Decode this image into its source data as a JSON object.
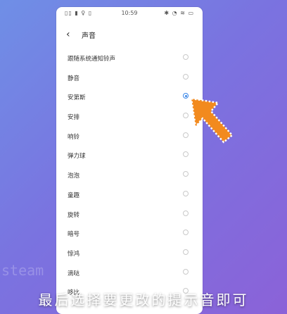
{
  "statusbar": {
    "left": "▯▯ ▮ ♀ ▯",
    "time": "10:59",
    "right": "✱ ◔ ≋ ▭"
  },
  "header": {
    "back_icon": "‹",
    "title": "声音"
  },
  "sounds": [
    {
      "label": "跟随系统通知铃声",
      "selected": false
    },
    {
      "label": "静音",
      "selected": false
    },
    {
      "label": "安第斯",
      "selected": true
    },
    {
      "label": "安排",
      "selected": false
    },
    {
      "label": "响铃",
      "selected": false
    },
    {
      "label": "弹力球",
      "selected": false
    },
    {
      "label": "泡泡",
      "selected": false
    },
    {
      "label": "童趣",
      "selected": false
    },
    {
      "label": "旋转",
      "selected": false
    },
    {
      "label": "暗号",
      "selected": false
    },
    {
      "label": "惊鸿",
      "selected": false
    },
    {
      "label": "滴哒",
      "selected": false
    },
    {
      "label": "哆比",
      "selected": false
    }
  ],
  "caption": "最后选择要更改的提示音即可",
  "watermark": "steam",
  "colors": {
    "accent": "#3a86e8",
    "arrow": "#f28a1e"
  }
}
